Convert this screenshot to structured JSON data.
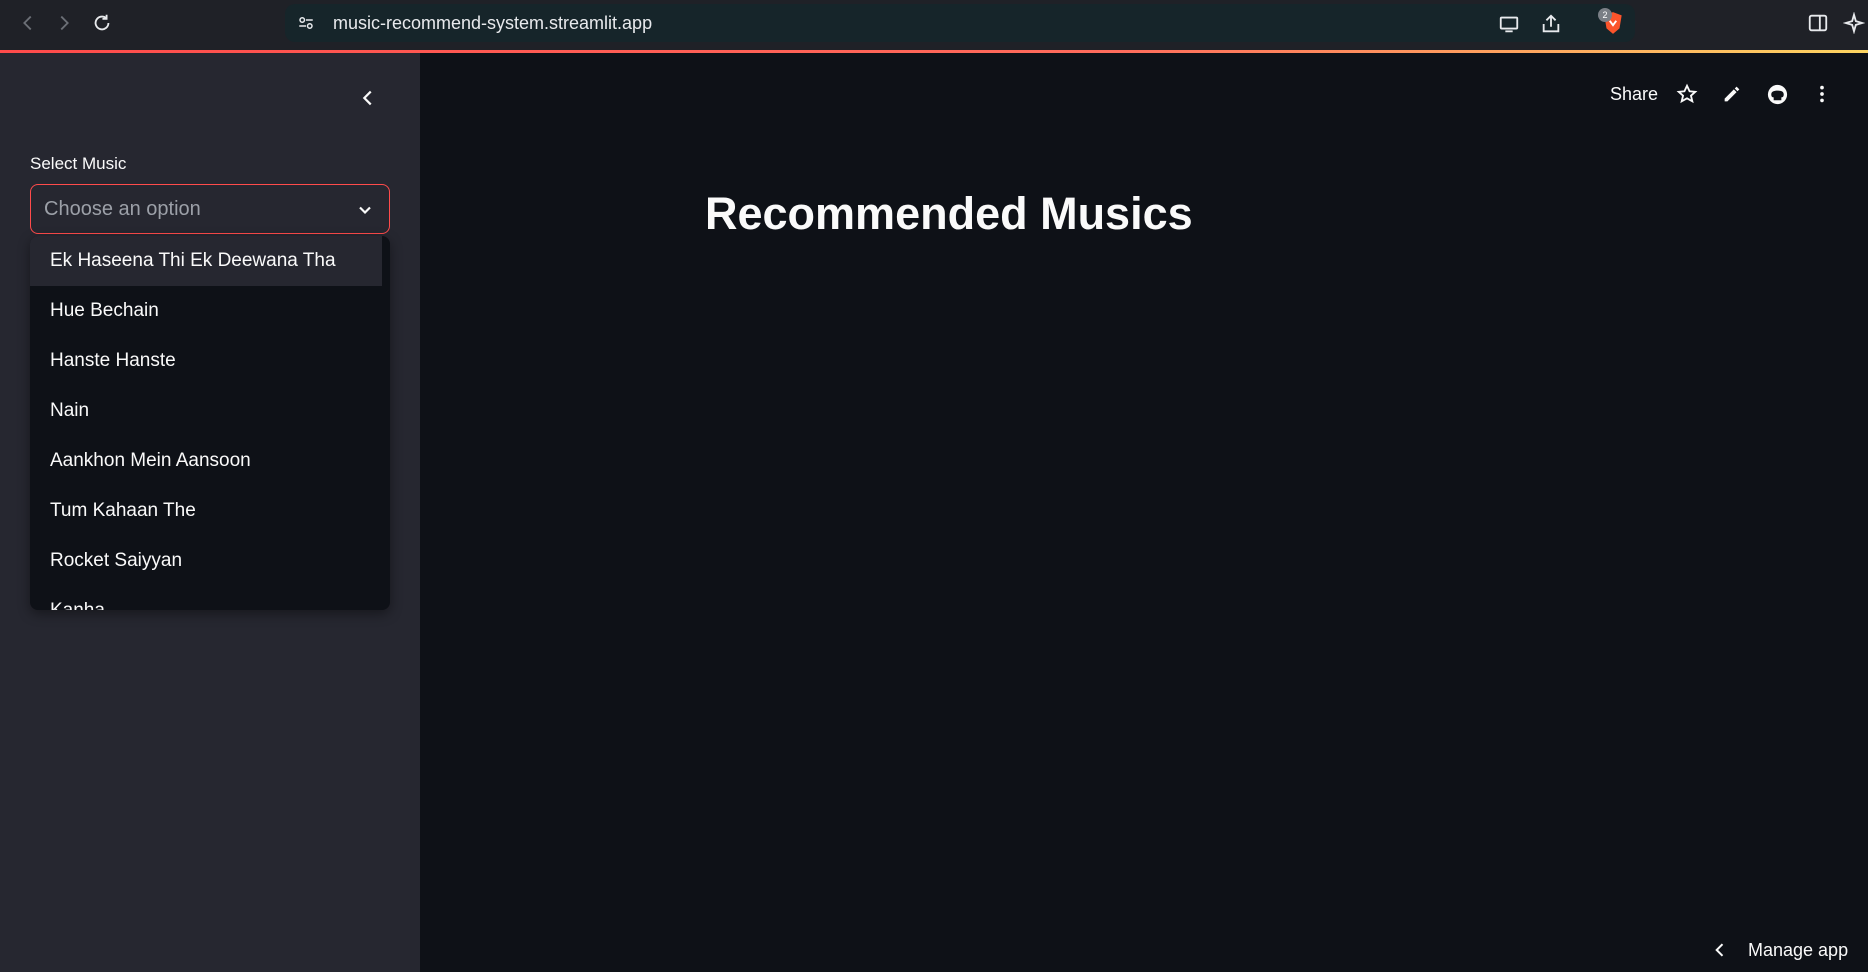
{
  "browser": {
    "url": "music-recommend-system.streamlit.app",
    "extension_badge_count": "2"
  },
  "sidebar": {
    "select_label": "Select Music",
    "select_placeholder": "Choose an option",
    "options": [
      "Ek Haseena Thi Ek Deewana Tha",
      "Hue Bechain",
      "Hanste Hanste",
      "Nain",
      "Aankhon Mein Aansoon",
      "Tum Kahaan The",
      "Rocket Saiyyan",
      "Kanha"
    ]
  },
  "main": {
    "title": "Recommended Musics"
  },
  "toolbar": {
    "share_label": "Share"
  },
  "footer": {
    "manage_app_label": "Manage app"
  },
  "colors": {
    "accent": "#ff4b4b",
    "background": "#0e1117",
    "sidebar": "#262730"
  }
}
